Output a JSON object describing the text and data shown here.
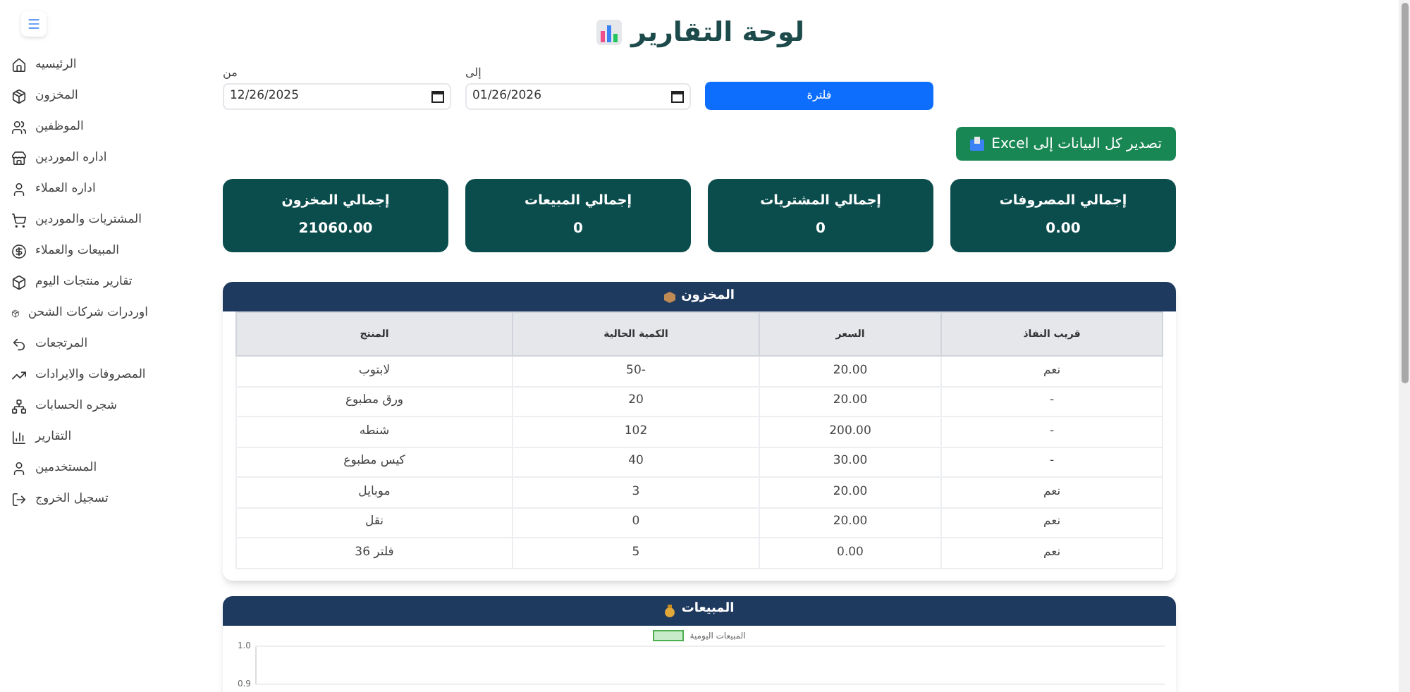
{
  "sidebar": {
    "items": [
      {
        "label": "الرئيسيه"
      },
      {
        "label": "المخزون"
      },
      {
        "label": "الموظفين"
      },
      {
        "label": "اداره الموردين"
      },
      {
        "label": "اداره العملاء"
      },
      {
        "label": "المشتريات والموردين"
      },
      {
        "label": "المبيعات والعملاء"
      },
      {
        "label": "تقارير منتجات اليوم"
      },
      {
        "label": "اوردرات شركات الشحن"
      },
      {
        "label": "المرتجعات"
      },
      {
        "label": "المصروفات والايرادات"
      },
      {
        "label": "شجره الحسابات"
      },
      {
        "label": "التقارير"
      },
      {
        "label": "المستخدمين"
      },
      {
        "label": "تسجيل الخروج"
      }
    ]
  },
  "title": "لوحة التقارير",
  "filters": {
    "from": {
      "label": "من",
      "value": "12/26/2025"
    },
    "to": {
      "label": "إلى",
      "value": "01/26/2026"
    },
    "button": "فلترة"
  },
  "export_button": "تصدير كل البيانات إلى Excel",
  "cards": [
    {
      "label": "إجمالي المصروفات",
      "value": "0.00"
    },
    {
      "label": "إجمالي المشتريات",
      "value": "0"
    },
    {
      "label": "إجمالي المبيعات",
      "value": "0"
    },
    {
      "label": "إجمالي المخزون",
      "value": "21060.00"
    }
  ],
  "inventory": {
    "title": "المخزون",
    "columns": [
      "قريب النفاذ",
      "السعر",
      "الكمية الحالية",
      "المنتج"
    ],
    "rows": [
      [
        "نعم",
        "20.00",
        "-50",
        "لابتوب"
      ],
      [
        "-",
        "20.00",
        "20",
        "ورق مطبوع"
      ],
      [
        "-",
        "200.00",
        "102",
        "شنطه"
      ],
      [
        "-",
        "30.00",
        "40",
        "كيس مطبوع"
      ],
      [
        "نعم",
        "20.00",
        "3",
        "موبايل"
      ],
      [
        "نعم",
        "20.00",
        "0",
        "نقل"
      ],
      [
        "نعم",
        "0.00",
        "5",
        "فلتر 36"
      ]
    ]
  },
  "sales": {
    "title": "المبيعات",
    "chart_data": {
      "type": "line",
      "ylim": [
        0.9,
        1
      ],
      "series": [
        {
          "name": "المبيعات اليومية",
          "color": "#4caf50"
        }
      ],
      "yticks": [
        {
          "value": 1,
          "label": "1.0"
        },
        {
          "value": 0.9,
          "label": "0.9"
        }
      ]
    }
  }
}
